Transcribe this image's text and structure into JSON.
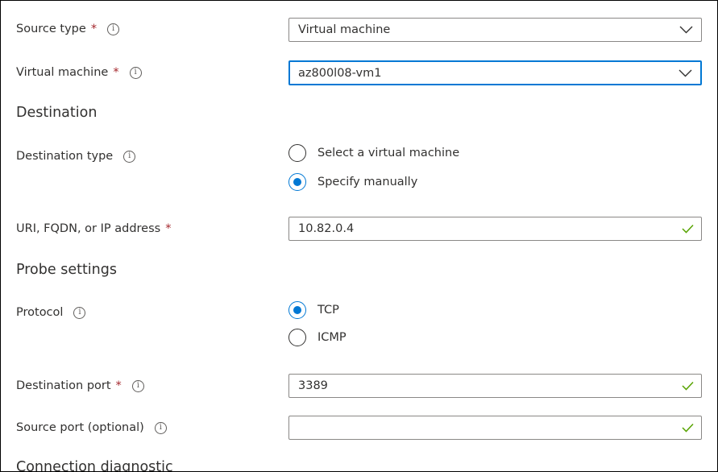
{
  "form": {
    "source_type": {
      "label": "Source type",
      "required_mark": "*",
      "info": "i",
      "value": "Virtual machine"
    },
    "virtual_machine": {
      "label": "Virtual machine",
      "required_mark": "*",
      "info": "i",
      "value": "az800l08-vm1"
    },
    "destination_section": "Destination",
    "destination_type": {
      "label": "Destination type",
      "info": "i",
      "options": [
        {
          "label": "Select a virtual machine",
          "selected": false
        },
        {
          "label": "Specify manually",
          "selected": true
        }
      ]
    },
    "address": {
      "label": "URI, FQDN, or IP address",
      "required_mark": "*",
      "value": "10.82.0.4",
      "valid": true
    },
    "probe_section": "Probe settings",
    "protocol": {
      "label": "Protocol",
      "info": "i",
      "options": [
        {
          "label": "TCP",
          "selected": true
        },
        {
          "label": "ICMP",
          "selected": false
        }
      ]
    },
    "destination_port": {
      "label": "Destination port",
      "required_mark": "*",
      "info": "i",
      "value": "3389",
      "valid": true
    },
    "source_port": {
      "label": "Source port (optional)",
      "info": "i",
      "value": "",
      "valid": true
    },
    "diagnostic_section": "Connection diagnostic"
  },
  "icons": {
    "info": "info-icon",
    "dropdown": "chevron-down-icon",
    "valid": "checkmark-icon"
  },
  "colors": {
    "accent": "#0078d4",
    "required": "#a4262c",
    "valid": "#57a300",
    "text": "#323130",
    "border": "#8a8886"
  }
}
